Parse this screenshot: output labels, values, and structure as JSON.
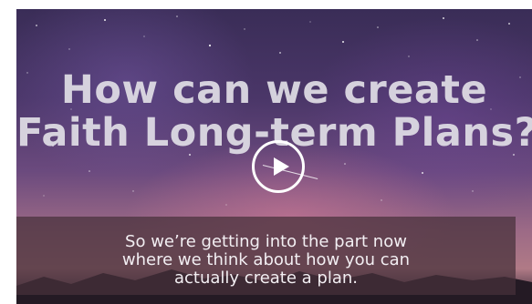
{
  "video": {
    "title_lines": [
      "How can we create",
      "Faith Long-term Plans?"
    ],
    "caption_lines": [
      "So we’re getting into the part now",
      "where we think about how you can",
      "actually create a plan."
    ],
    "play_icon": "play-icon",
    "colors": {
      "title_text": "#e1dee6",
      "caption_bg": "#46303a",
      "caption_text": "#f2eef2",
      "sky_top": "#3a2d57",
      "sky_horizon": "#b07a86"
    }
  }
}
